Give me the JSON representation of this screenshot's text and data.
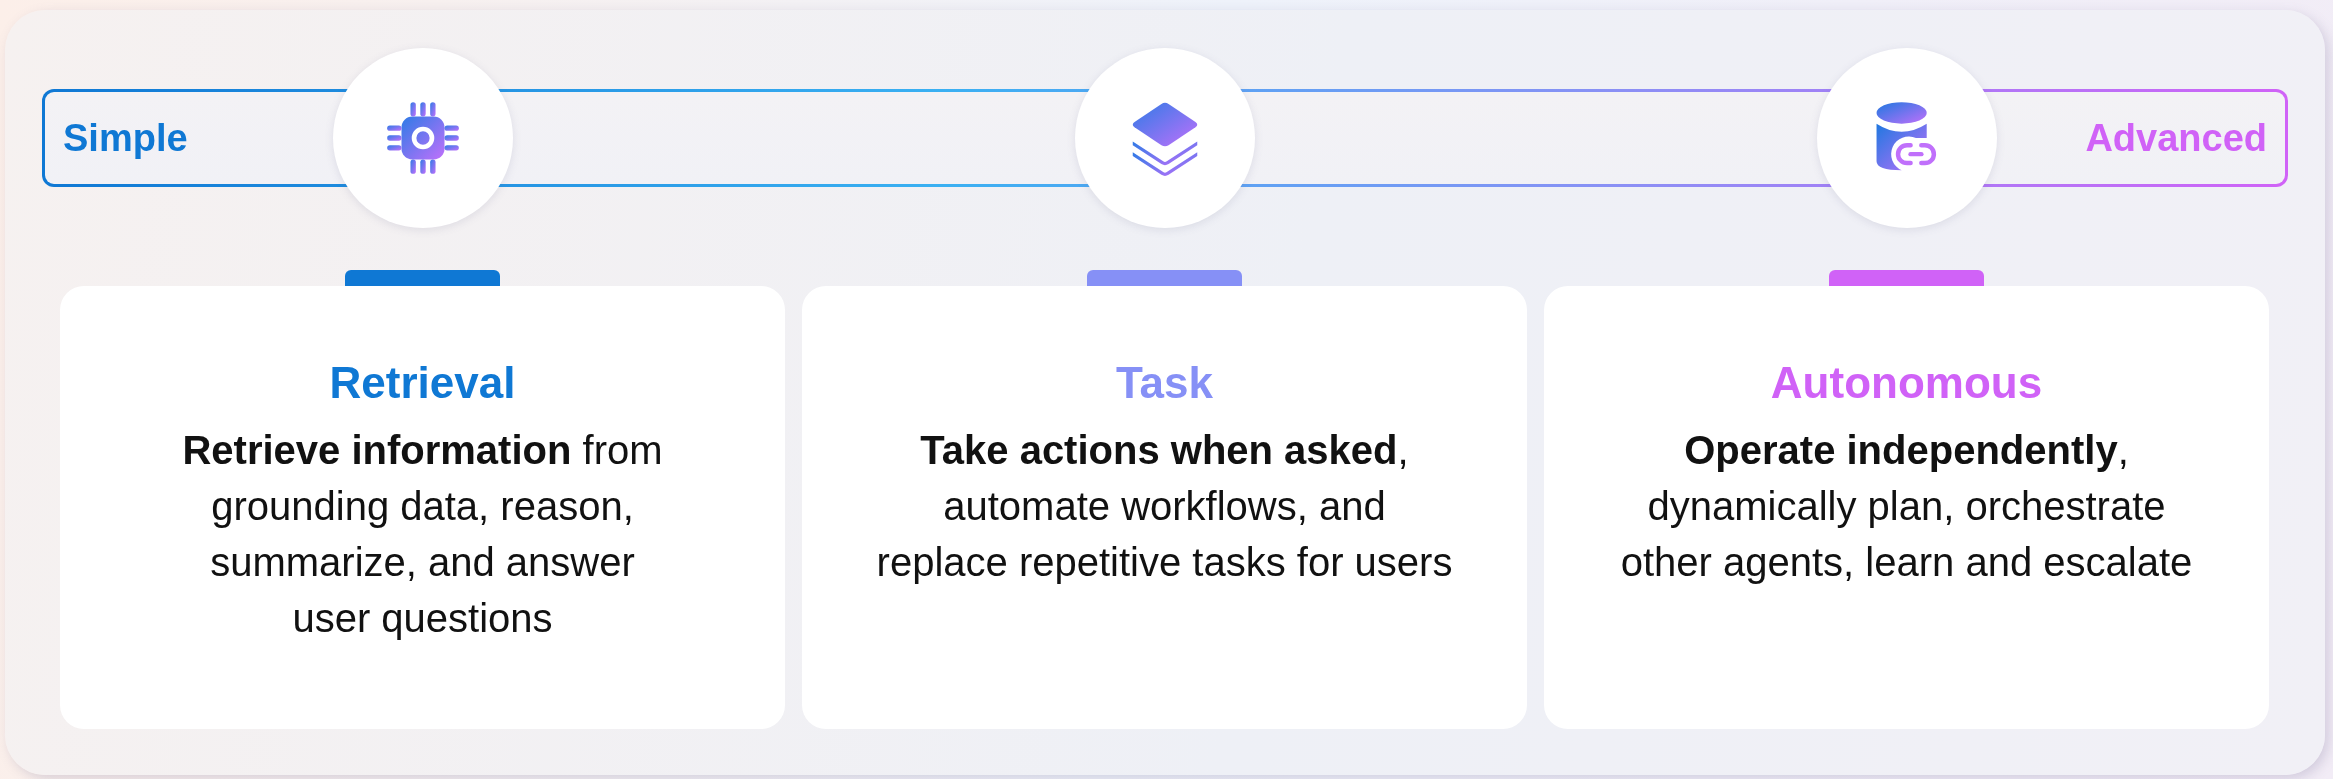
{
  "scale": {
    "start_label": "Simple",
    "end_label": "Advanced"
  },
  "cards": [
    {
      "title": "Retrieval",
      "color": "#0f78d4",
      "text": "**Retrieve information** from\ngrounding data, reason,\nsummarize, and answer\nuser questions"
    },
    {
      "title": "Task",
      "color": "#8690f6",
      "text": "**Take actions when asked**,\nautomate workflows, and\nreplace repetitive tasks for users"
    },
    {
      "title": "Autonomous",
      "color": "#d062f7",
      "text": "**Operate independently**,\ndynamically plan, orchestrate\nother agents, learn and escalate"
    }
  ]
}
